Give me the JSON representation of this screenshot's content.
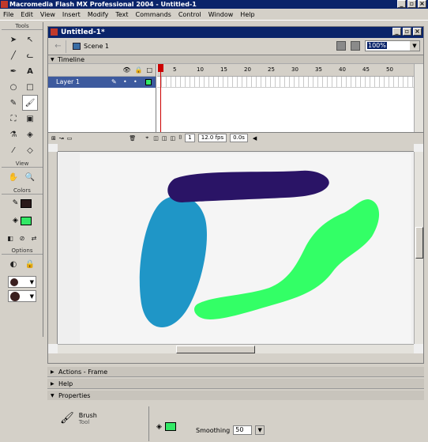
{
  "app": {
    "title": "Macromedia Flash MX Professional 2004 - Untitled-1",
    "menu": [
      "File",
      "Edit",
      "View",
      "Insert",
      "Modify",
      "Text",
      "Commands",
      "Control",
      "Window",
      "Help"
    ]
  },
  "tools": {
    "title": "Tools",
    "view_title": "View",
    "colors_title": "Colors",
    "options_title": "Options",
    "stroke_color": "#2b1a1a",
    "fill_color": "#33e866"
  },
  "document": {
    "title": "Untitled-1*",
    "scene": "Scene 1",
    "zoom": "100%",
    "timeline_label": "Timeline",
    "layer_name": "Layer 1",
    "ruler_ticks": [
      "5",
      "10",
      "15",
      "20",
      "25",
      "30",
      "35",
      "40",
      "45",
      "50"
    ],
    "current_frame": "1",
    "fps": "12.0 fps",
    "elapsed": "0.0s"
  },
  "stage": {
    "shapes": [
      {
        "name": "dark-purple-stroke",
        "color": "#2a1466"
      },
      {
        "name": "blue-stroke",
        "color": "#1f96c7"
      },
      {
        "name": "green-stroke",
        "color": "#33ff66"
      }
    ]
  },
  "panels": {
    "actions": "Actions - Frame",
    "help": "Help",
    "properties": "Properties"
  },
  "properties": {
    "tool_name": "Brush",
    "tool_sub": "Tool",
    "smoothing_label": "Smoothing",
    "smoothing_value": "50",
    "fill_color": "#33e866"
  }
}
